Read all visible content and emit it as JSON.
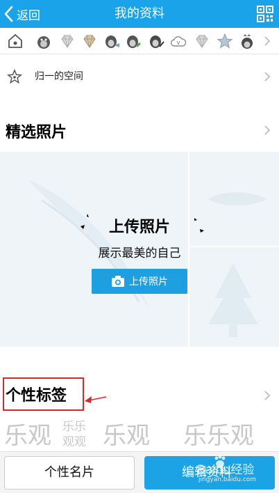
{
  "header": {
    "back_label": "返回",
    "title": "我的资料",
    "bg_color": "#1aa3e8"
  },
  "badges": {
    "icons": [
      "home-star-icon",
      "penguin-gray-icon",
      "diamond-gray-icon",
      "diamond-tan-icon",
      "penguin-fish-icon",
      "penguin-green-icon",
      "penguin-pen-icon",
      "cloud-vip-icon",
      "diamond-gray-icon",
      "star-blue-icon",
      "penguin-crown-icon"
    ]
  },
  "space_row": {
    "label": "归一的空间",
    "icon": "star-outline-icon"
  },
  "photos": {
    "section_title": "精选照片",
    "upload_title": "上传照片",
    "upload_subtitle": "展示最美的自己",
    "upload_button": "上传照片"
  },
  "tags": {
    "section_title": "个性标签",
    "watermark_text": [
      "乐观",
      "乐乐",
      "观观",
      "乐观",
      "乐乐观"
    ]
  },
  "bottom": {
    "card_button": "个性名片",
    "edit_button": "编辑资料",
    "watermark": "Baidu经验",
    "watermark_url": "jingyan.baidu.com"
  }
}
